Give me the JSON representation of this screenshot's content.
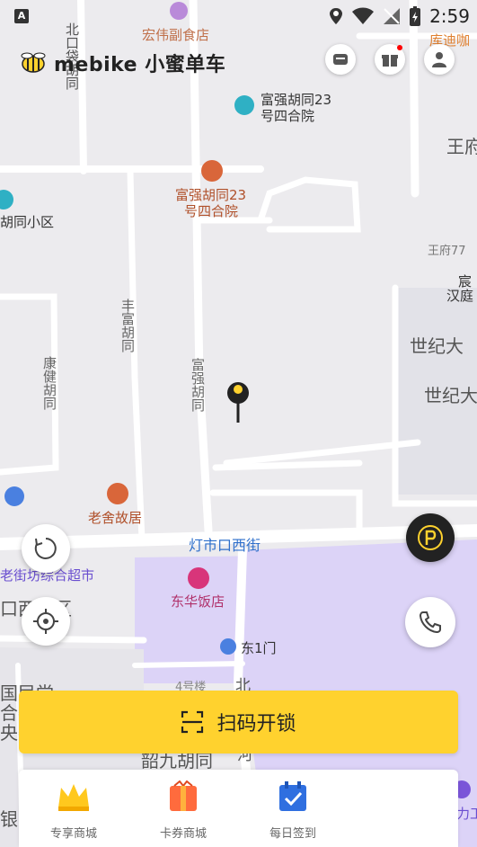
{
  "status_bar": {
    "left_badge": "A",
    "time": "2:59"
  },
  "header": {
    "brand": "mebike 小蜜单车",
    "icons": [
      "cabinet-icon",
      "gift-icon",
      "user-icon"
    ],
    "gift_has_notification": true
  },
  "map": {
    "labels": {
      "beikoudai": "北口袋胡同",
      "hongwei": "宏伟副食店",
      "kuidi": "库迪咖",
      "fuqiang_poi_1": "富强胡同23",
      "fuqiang_poi_2": "号四合院",
      "fuqiang_b1": "富强胡同23",
      "fuqiang_b2": "号四合院",
      "wangfu": "王府",
      "wangfu77": "王府77",
      "tonghutong": "胡同小区",
      "chen": "宸",
      "hanting": "汉庭",
      "shijidasha1": "世纪大",
      "shijidasha2": "世纪大",
      "fengfu": "丰富胡同",
      "kangjian": "康健胡同",
      "fuqiang_road": "富强胡同",
      "laoshe": "老舍故居",
      "dengshikou": "灯市口西街",
      "laojiefang": "老街坊综合超市",
      "donghua": "东华饭店",
      "kouxi": "口西小区",
      "dongmen": "东1门",
      "building4": "4号楼",
      "shaojiu": "韶九胡同",
      "guoguomin": "国民党",
      "he": "合委",
      "zhongyang": "央委",
      "bei": "北",
      "he2": "河",
      "yin": "银",
      "li": "力工"
    }
  },
  "buttons": {
    "scan_label": "扫码开锁"
  },
  "bottom_nav": [
    {
      "label": "专享商城",
      "icon": "crown-icon"
    },
    {
      "label": "卡券商城",
      "icon": "coupon-bag-icon"
    },
    {
      "label": "每日签到",
      "icon": "calendar-check-icon"
    }
  ],
  "colors": {
    "accent": "#FFD22E",
    "map_bg": "#ECEBEE",
    "poi_purple": "#DCD3F7",
    "road": "#FFFFFF"
  }
}
